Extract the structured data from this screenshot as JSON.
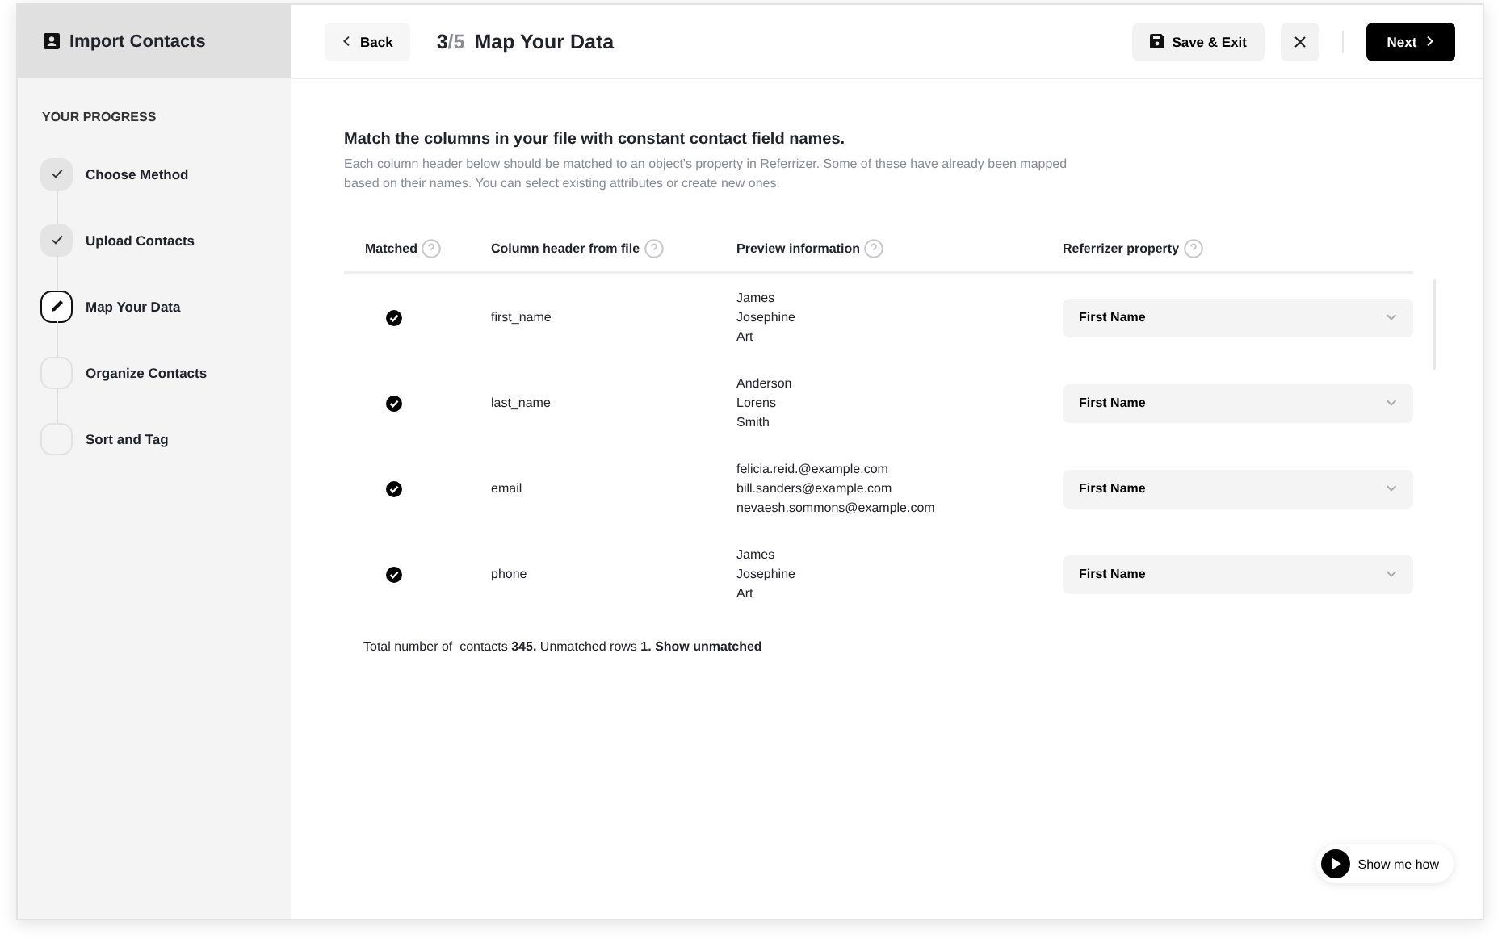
{
  "sidebar": {
    "title": "Import Contacts",
    "progress_label": "YOUR PROGRESS",
    "steps": [
      {
        "label": "Choose Method",
        "kind": "done"
      },
      {
        "label": "Upload Contacts",
        "kind": "done"
      },
      {
        "label": "Map Your Data",
        "kind": "current"
      },
      {
        "label": "Organize Contacts",
        "kind": "pending"
      },
      {
        "label": "Sort and Tag",
        "kind": "pending"
      }
    ]
  },
  "header": {
    "back": "Back",
    "step_current": "3",
    "step_total": "/5",
    "title": "Map Your Data",
    "save": "Save & Exit",
    "next": "Next"
  },
  "intro": {
    "heading": "Match the columns in your file with constant contact field names.",
    "description": "Each column header below should be matched to an object's property in Referrizer. Some of these have already been mapped based on their names.  You can select existing attributes or create new ones."
  },
  "table": {
    "columns": [
      "Matched",
      "Column header from file",
      "Preview information",
      "Referrizer property"
    ],
    "rows": [
      {
        "matched": true,
        "column_header": "first_name",
        "preview": [
          "James",
          "Josephine",
          "Art"
        ],
        "property": "First Name"
      },
      {
        "matched": true,
        "column_header": "last_name",
        "preview": [
          "Anderson",
          "Lorens",
          "Smith"
        ],
        "property": "First Name"
      },
      {
        "matched": true,
        "column_header": "email",
        "preview": [
          "felicia.reid.@example.com",
          "bill.sanders@example.com",
          "nevaesh.sommons@example.com"
        ],
        "property": "First Name"
      },
      {
        "matched": true,
        "column_header": "phone",
        "preview": [
          "James",
          "Josephine",
          "Art"
        ],
        "property": "First Name"
      }
    ]
  },
  "summary": {
    "text": "Total number of  contacts **345.** Unmatched rows **1.**",
    "link": "Show unmatched"
  },
  "help_button": "Show me how"
}
